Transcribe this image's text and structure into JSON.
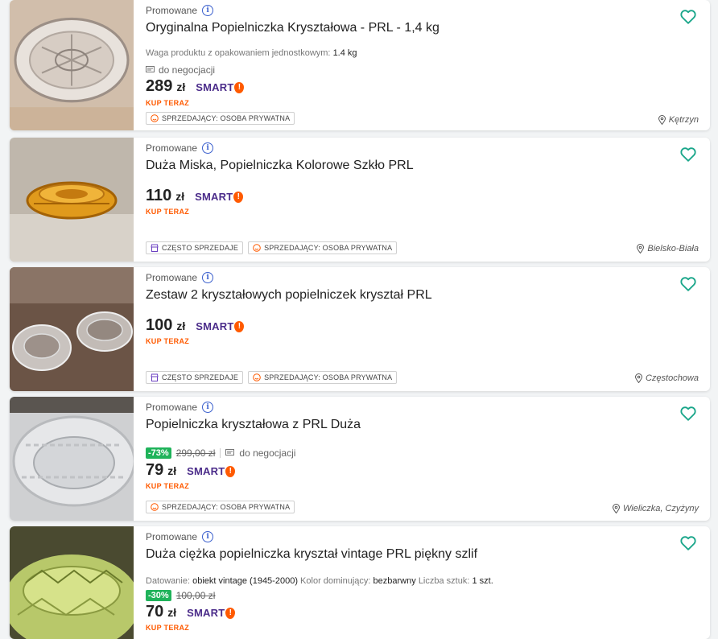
{
  "listings": [
    {
      "promo": "Promowane",
      "title": "Oryginalna Popielniczka Kryształowa - PRL - 1,4 kg",
      "param_label": "Waga produktu z opakowaniem jednostkowym:",
      "param_value": "1.4 kg",
      "negotiation": "do negocjacji",
      "price": "289",
      "currency": "zł",
      "smart": "SMART",
      "buy_now": "KUP TERAZ",
      "tag_seller": "SPRZEDAJĄCY: OSOBA PRYWATNA",
      "location": "Kętrzyn"
    },
    {
      "promo": "Promowane",
      "title": "Duża Miska, Popielniczka Kolorowe Szkło PRL",
      "price": "110",
      "currency": "zł",
      "smart": "SMART",
      "buy_now": "KUP TERAZ",
      "tag_often": "CZĘSTO SPRZEDAJE",
      "tag_seller": "SPRZEDAJĄCY: OSOBA PRYWATNA",
      "location": "Bielsko-Biała"
    },
    {
      "promo": "Promowane",
      "title": "Zestaw 2 kryształowych popielniczek kryształ PRL",
      "price": "100",
      "currency": "zł",
      "smart": "SMART",
      "buy_now": "KUP TERAZ",
      "tag_often": "CZĘSTO SPRZEDAJE",
      "tag_seller": "SPRZEDAJĄCY: OSOBA PRYWATNA",
      "location": "Częstochowa"
    },
    {
      "promo": "Promowane",
      "title": "Popielniczka kryształowa z PRL Duża",
      "discount": "-73%",
      "old_price": "299,00 zł",
      "negotiation": "do negocjacji",
      "price": "79",
      "currency": "zł",
      "smart": "SMART",
      "buy_now": "KUP TERAZ",
      "tag_seller": "SPRZEDAJĄCY: OSOBA PRYWATNA",
      "location": "Wieliczka, Czyżyny"
    },
    {
      "promo": "Promowane",
      "title": "Duża ciężka popielniczka kryształ vintage PRL piękny szlif",
      "p1_label": "Datowanie:",
      "p1_value": "obiekt vintage (1945-2000)",
      "p2_label": "Kolor dominujący:",
      "p2_value": "bezbarwny",
      "p3_label": "Liczba sztuk:",
      "p3_value": "1 szt.",
      "discount": "-30%",
      "old_price": "100,00 zł",
      "price": "70",
      "currency": "zł",
      "smart": "SMART",
      "buy_now": "KUP TERAZ"
    }
  ],
  "colors": {
    "heart": "#1aa68a",
    "buy_now": "#ff5a00",
    "smart_text": "#4b2c8a",
    "discount": "#1fb35a",
    "info": "#3a5fcd"
  },
  "icons": {
    "favorite": "heart-outline-icon",
    "info": "info-icon",
    "location": "map-pin-icon",
    "negotiation": "chat-icon",
    "seller": "smiley-icon",
    "often_sells": "shop-icon"
  }
}
